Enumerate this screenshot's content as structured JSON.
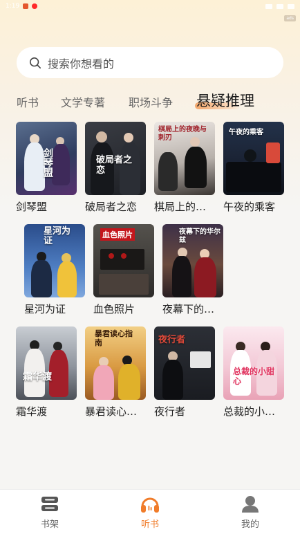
{
  "status": {
    "time": "1:19",
    "badge": "ads"
  },
  "search": {
    "placeholder": "搜索你想看的"
  },
  "tabs": [
    {
      "label": "听书"
    },
    {
      "label": "文学专著"
    },
    {
      "label": "职场斗争"
    },
    {
      "label": "悬疑推理",
      "active": true
    }
  ],
  "books": [
    {
      "title": "剑琴盟",
      "cover_text": "剑琴盟"
    },
    {
      "title": "破局者之恋",
      "cover_text": "破局者之恋"
    },
    {
      "title": "棋局上的…",
      "cover_text": "棋局上的夜晚与刺刃"
    },
    {
      "title": "午夜的乘客",
      "cover_text": "午夜的乘客"
    },
    {
      "title": "星河为证",
      "cover_text": "星河为证"
    },
    {
      "title": "血色照片",
      "cover_text": "血色照片"
    },
    {
      "title": "夜幕下的…",
      "cover_text": "夜幕下的华尔兹"
    },
    {
      "title": "霜华渡",
      "cover_text": "霜华渡"
    },
    {
      "title": "暴君读心…",
      "cover_text": "暴君读心指南"
    },
    {
      "title": "夜行者",
      "cover_text": "夜行者"
    },
    {
      "title": "总裁的小…",
      "cover_text": "总裁的小甜心"
    }
  ],
  "nav": [
    {
      "label": "书架",
      "icon": "bookshelf-icon"
    },
    {
      "label": "听书",
      "icon": "headphones-icon",
      "active": true
    },
    {
      "label": "我的",
      "icon": "profile-icon"
    }
  ],
  "colors": {
    "accent": "#f07c2a",
    "background": "#f6f5f3"
  }
}
